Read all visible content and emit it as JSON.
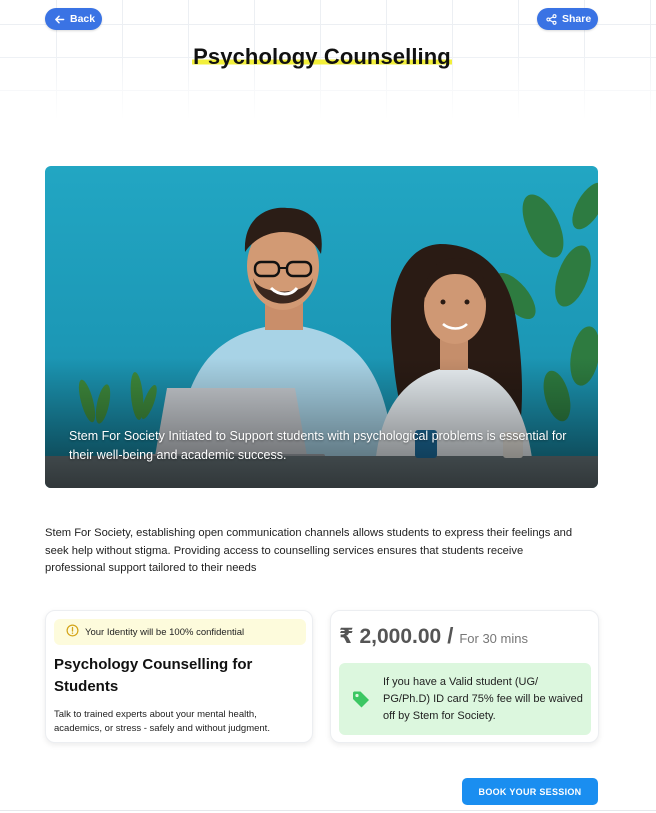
{
  "header": {
    "back_label": "Back",
    "share_label": "Share",
    "title": "Psychology Counselling"
  },
  "hero": {
    "caption": "Stem For Society Initiated to Support students with psychological problems is essential for their well-being and academic success."
  },
  "description": "Stem For Society, establishing open communication channels allows students to express their feelings and seek help without stigma. Providing access to counselling services ensures that students receive professional support tailored to their needs",
  "service_card": {
    "confidential_note": "Your Identity will be 100% confidential",
    "title": "Psychology Counselling for Students",
    "subtitle": "Talk to trained experts about your mental health, academics, or stress - safely and without judgment."
  },
  "price_card": {
    "price": "₹ 2,000.00",
    "separator": "/",
    "duration": "For 30 mins",
    "discount_note": "If you have a Valid student (UG/ PG/Ph.D) ID card 75% fee will be waived off by Stem for Society."
  },
  "cta": {
    "book_label": "BOOK YOUR SESSION"
  },
  "colors": {
    "primary_blue": "#3a73e4",
    "cta_blue": "#1a8ef0",
    "highlight_yellow": "#f2ef3a",
    "note_yellow_bg": "#fdfbdc",
    "discount_green_bg": "#dcf7de",
    "tag_green": "#3cc763"
  },
  "icons": {
    "back": "arrow-left-icon",
    "share": "share-icon",
    "confidential": "alert-circle-icon",
    "discount": "tag-icon"
  }
}
